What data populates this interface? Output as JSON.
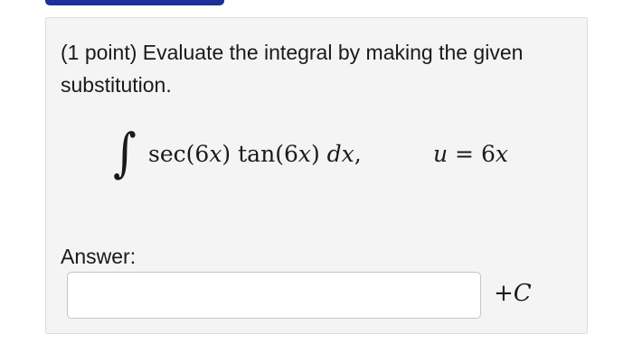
{
  "problem": {
    "prompt": "(1 point) Evaluate the integral by making the given substitution.",
    "integral_symbol": "∫",
    "integrand": {
      "sec_fn": "sec",
      "sec_arg_open": "(6",
      "sec_var": "x",
      "sec_arg_close": ") ",
      "tan_fn": "tan",
      "tan_arg_open": "(6",
      "tan_var": "x",
      "tan_arg_close": ") ",
      "differential": "dx",
      "trailing": ","
    },
    "substitution": {
      "variable": "u",
      "equals": " = 6",
      "var": "x"
    }
  },
  "answer": {
    "label": "Answer:",
    "value": "",
    "constant_prefix": "+",
    "constant": "C"
  }
}
